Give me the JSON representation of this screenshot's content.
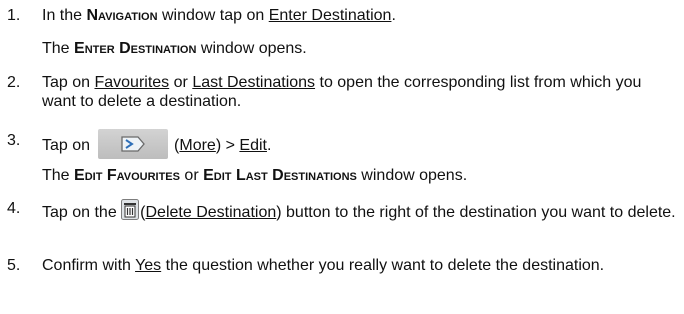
{
  "steps": [
    {
      "num": "1.",
      "line": [
        "In the ",
        "Navigation",
        " window tap on ",
        "Enter Destination",
        "."
      ],
      "result": [
        "The ",
        "Enter Destination",
        " window opens."
      ]
    },
    {
      "num": "2.",
      "line": [
        "Tap on ",
        "Favourites",
        " or ",
        "Last Destinations",
        " to open the corresponding list from which you want to delete a destination."
      ]
    },
    {
      "num": "3.",
      "line": [
        "Tap on",
        "(",
        "More",
        ") > ",
        "Edit",
        "."
      ],
      "result": [
        "The ",
        "Edit Favourites",
        " or ",
        "Edit Last Destinations",
        " window opens."
      ],
      "button_icon": "more-arrow-icon"
    },
    {
      "num": "4.",
      "line": [
        "Tap on the ",
        "(",
        "Delete Destination",
        ") button to the right of the destination you want to delete."
      ],
      "icon": "trash-icon"
    },
    {
      "num": "5.",
      "line": [
        "Confirm with ",
        "Yes",
        " the question whether you really want to delete the destination."
      ]
    }
  ]
}
